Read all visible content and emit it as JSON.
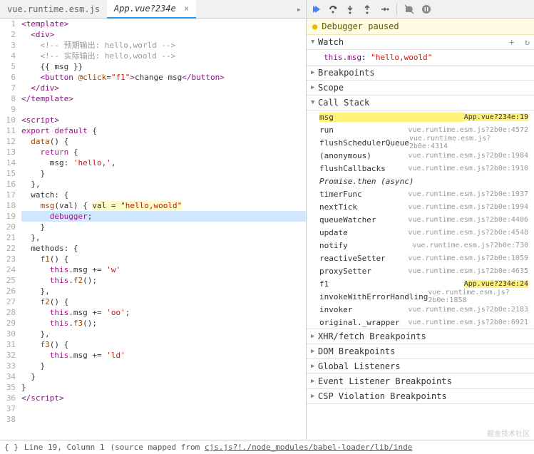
{
  "tabs": {
    "inactive": "vue.runtime.esm.js",
    "active": "App.vue?234e",
    "close": "×",
    "nav_icon": "▸"
  },
  "code": {
    "lines": [
      {
        "n": 1,
        "html": "<t-tag>&lt;template&gt;</t-tag>"
      },
      {
        "n": 2,
        "html": "  <t-tag>&lt;div&gt;</t-tag>"
      },
      {
        "n": 3,
        "html": "    <t-comment>&lt;!-- 预期输出: hello,world --&gt;</t-comment>"
      },
      {
        "n": 4,
        "html": "    <t-comment>&lt;!-- 实际输出: hello,woold --&gt;</t-comment>"
      },
      {
        "n": 5,
        "html": "    {{ msg }}"
      },
      {
        "n": 6,
        "html": "    <t-tag>&lt;button</t-tag> <t-attr>@click</t-attr>=<t-str>\"f1\"</t-str><t-tag>&gt;</t-tag>change msg<t-tag>&lt;/button&gt;</t-tag>"
      },
      {
        "n": 7,
        "html": "  <t-tag>&lt;/div&gt;</t-tag>"
      },
      {
        "n": 8,
        "html": "<t-tag>&lt;/template&gt;</t-tag>"
      },
      {
        "n": 9,
        "html": ""
      },
      {
        "n": 10,
        "html": "<t-tag>&lt;script&gt;</t-tag>"
      },
      {
        "n": 11,
        "html": "<t-kw>export default</t-kw> {"
      },
      {
        "n": 12,
        "html": "  <t-fn>data</t-fn>() {"
      },
      {
        "n": 13,
        "html": "    <t-kw>return</t-kw> {"
      },
      {
        "n": 14,
        "html": "      msg: <t-str>'hello,'</t-str>,"
      },
      {
        "n": 15,
        "html": "    }"
      },
      {
        "n": 16,
        "html": "  },"
      },
      {
        "n": 17,
        "html": "  watch: {"
      },
      {
        "n": 18,
        "html": "    <t-fn>msg</t-fn>(val) { <val>val = <t-str>\"hello,woold\"</t-str></val>"
      },
      {
        "n": 19,
        "html": "      <t-kw>debugger</t-kw>;",
        "hl": true
      },
      {
        "n": 20,
        "html": "    }"
      },
      {
        "n": 21,
        "html": "  },"
      },
      {
        "n": 22,
        "html": "  methods: {"
      },
      {
        "n": 23,
        "html": "    <t-fn>f1</t-fn>() {"
      },
      {
        "n": 24,
        "html": "      <t-kw>this</t-kw>.msg += <t-str>'w'</t-str>"
      },
      {
        "n": 25,
        "html": "      <t-kw>this</t-kw>.<t-fn>f2</t-fn>();"
      },
      {
        "n": 26,
        "html": "    },"
      },
      {
        "n": 27,
        "html": "    <t-fn>f2</t-fn>() {"
      },
      {
        "n": 28,
        "html": "      <t-kw>this</t-kw>.msg += <t-str>'oo'</t-str>;"
      },
      {
        "n": 29,
        "html": "      <t-kw>this</t-kw>.<t-fn>f3</t-fn>();"
      },
      {
        "n": 30,
        "html": "    },"
      },
      {
        "n": 31,
        "html": "    <t-fn>f3</t-fn>() {"
      },
      {
        "n": 32,
        "html": "      <t-kw>this</t-kw>.msg += <t-str>'ld'</t-str>"
      },
      {
        "n": 33,
        "html": "    }"
      },
      {
        "n": 34,
        "html": "  }"
      },
      {
        "n": 35,
        "html": "}"
      },
      {
        "n": 36,
        "html": "<t-tag>&lt;/script&gt;</t-tag>"
      },
      {
        "n": 37,
        "html": ""
      },
      {
        "n": 38,
        "html": ""
      }
    ]
  },
  "status": {
    "braces": "{ }",
    "pos": "Line 19, Column 1",
    "mapped": "(source mapped from ",
    "link": "cjs.js?!./node_modules/babel-loader/lib/inde"
  },
  "debugger": {
    "banner": "Debugger paused",
    "sections": {
      "watch": "Watch",
      "breakpoints": "Breakpoints",
      "scope": "Scope",
      "callstack": "Call Stack",
      "xhr": "XHR/fetch Breakpoints",
      "dom": "DOM Breakpoints",
      "global": "Global Listeners",
      "event": "Event Listener Breakpoints",
      "csp": "CSP Violation Breakpoints"
    },
    "watch_expr": "this.msg",
    "watch_val": "\"hello,woold\"",
    "stack": [
      {
        "fn": "msg",
        "loc": "App.vue?234e:19",
        "current": true,
        "highlighted": true
      },
      {
        "fn": "run",
        "loc": "vue.runtime.esm.js?2b0e:4572"
      },
      {
        "fn": "flushSchedulerQueue",
        "loc": "vue.runtime.esm.js?2b0e:4314"
      },
      {
        "fn": "(anonymous)",
        "loc": "vue.runtime.esm.js?2b0e:1984"
      },
      {
        "fn": "flushCallbacks",
        "loc": "vue.runtime.esm.js?2b0e:1910"
      },
      {
        "fn": "Promise.then (async)",
        "async": true
      },
      {
        "fn": "timerFunc",
        "loc": "vue.runtime.esm.js?2b0e:1937"
      },
      {
        "fn": "nextTick",
        "loc": "vue.runtime.esm.js?2b0e:1994"
      },
      {
        "fn": "queueWatcher",
        "loc": "vue.runtime.esm.js?2b0e:4406"
      },
      {
        "fn": "update",
        "loc": "vue.runtime.esm.js?2b0e:4548"
      },
      {
        "fn": "notify",
        "loc": "vue.runtime.esm.js?2b0e:730"
      },
      {
        "fn": "reactiveSetter",
        "loc": "vue.runtime.esm.js?2b0e:1059"
      },
      {
        "fn": "proxySetter",
        "loc": "vue.runtime.esm.js?2b0e:4635"
      },
      {
        "fn": "f1",
        "loc": "App.vue?234e:24",
        "highlighted": true
      },
      {
        "fn": "invokeWithErrorHandling",
        "loc": "vue.runtime.esm.js?2b0e:1858"
      },
      {
        "fn": "invoker",
        "loc": "vue.runtime.esm.js?2b0e:2183"
      },
      {
        "fn": "original._wrapper",
        "loc": "vue.runtime.esm.js?2b0e:6921"
      }
    ]
  },
  "watermark": "掘金技术社区"
}
